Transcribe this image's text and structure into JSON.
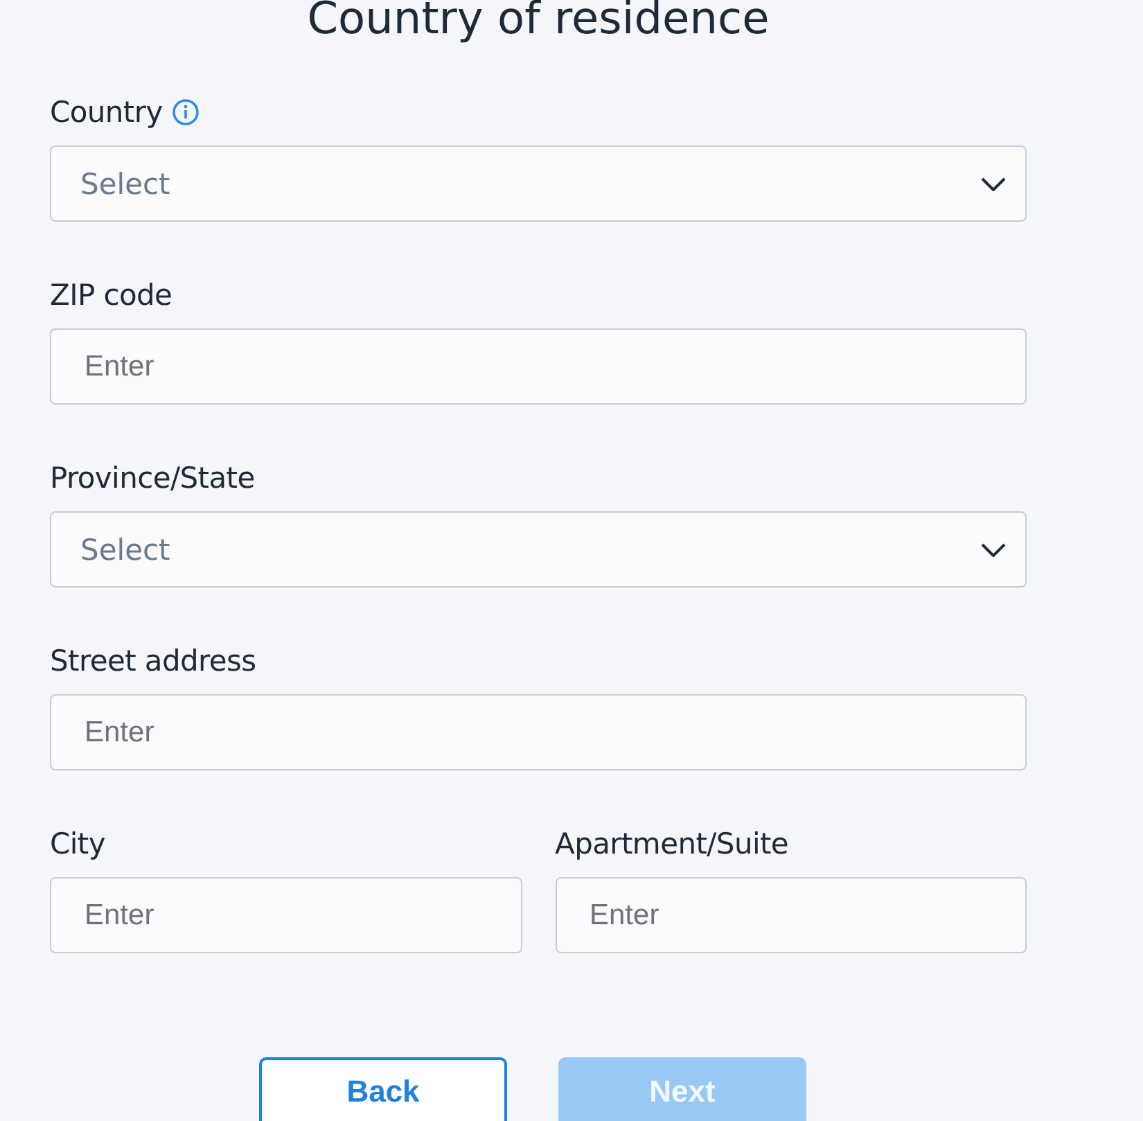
{
  "title": "Country of residence",
  "rows": [
    [
      {
        "label": "Country",
        "kind": "select",
        "placeholder": "Select",
        "info": true
      }
    ],
    [
      {
        "label": "ZIP code",
        "kind": "text",
        "placeholder": "Enter",
        "info": false
      }
    ],
    [
      {
        "label": "Province/State",
        "kind": "select",
        "placeholder": "Select",
        "info": false
      }
    ],
    [
      {
        "label": "Street address",
        "kind": "text",
        "placeholder": "Enter",
        "info": false
      }
    ],
    [
      {
        "label": "City",
        "kind": "text",
        "placeholder": "Enter",
        "info": false
      },
      {
        "label": "Apartment/Suite",
        "kind": "text",
        "placeholder": "Enter",
        "info": false
      }
    ]
  ],
  "buttons": [
    {
      "label": "Back",
      "kind": "secondary",
      "disabled": false
    },
    {
      "label": "Next",
      "kind": "primary",
      "disabled": true
    }
  ]
}
